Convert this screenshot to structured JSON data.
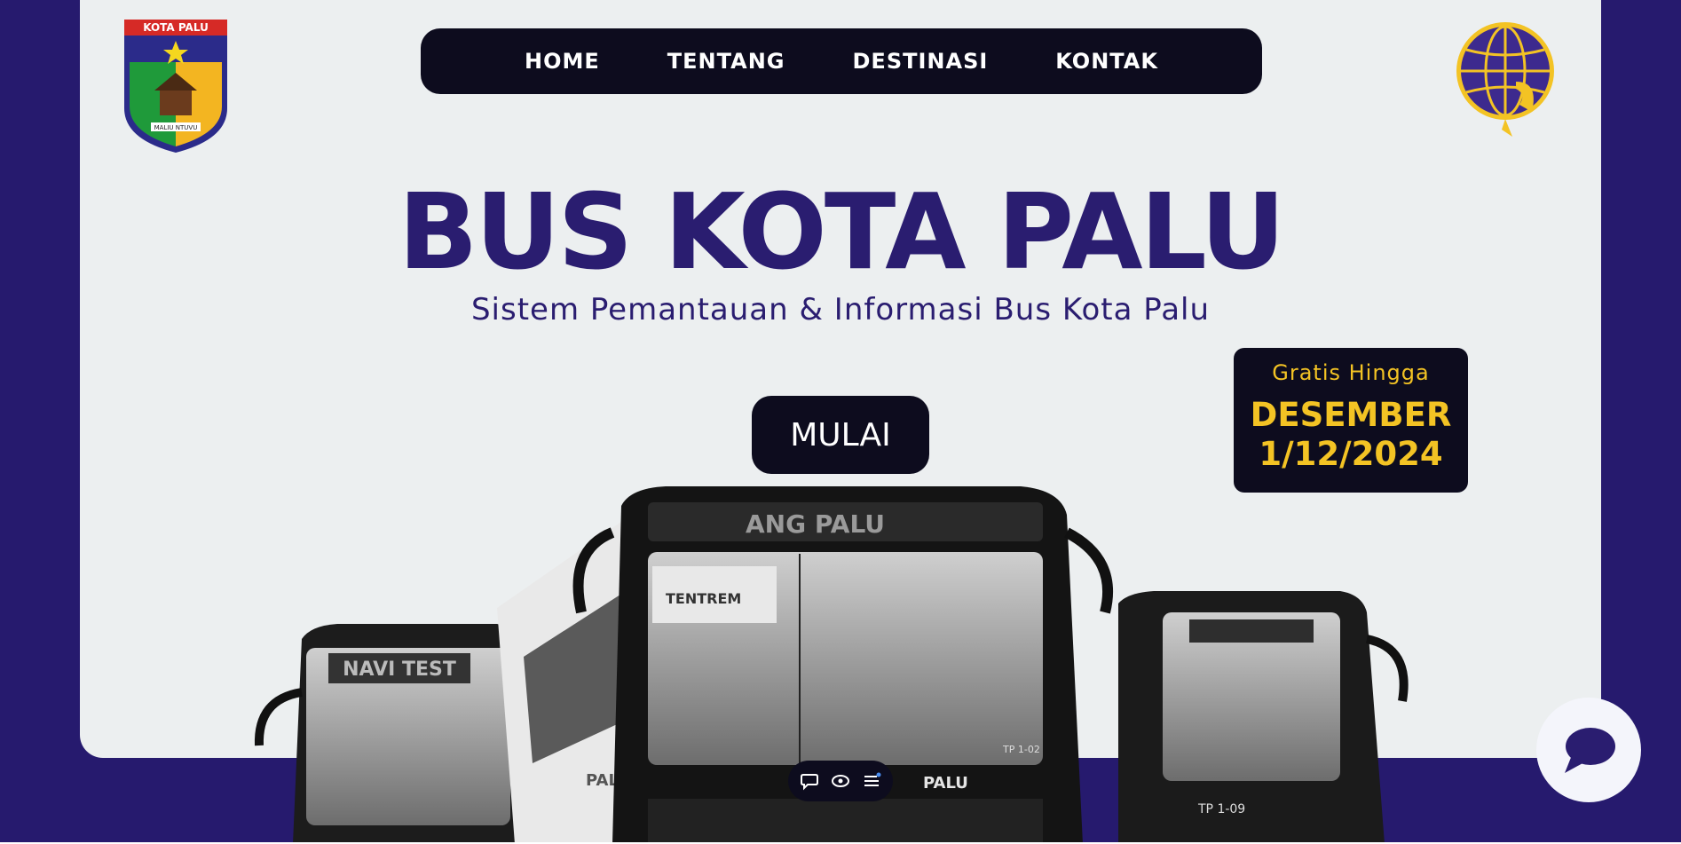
{
  "logos": {
    "left_banner_text": "KOTA PALU",
    "left_motto_text": "MALIU NTUVU"
  },
  "nav": {
    "items": [
      {
        "label": "HOME"
      },
      {
        "label": "TENTANG"
      },
      {
        "label": "DESTINASI"
      },
      {
        "label": "KONTAK"
      }
    ]
  },
  "hero": {
    "title": "BUS KOTA PALU",
    "subtitle": "Sistem Pemantauan & Informasi Bus Kota Palu",
    "start_button": "MULAI"
  },
  "promo": {
    "label": "Gratis Hingga",
    "month": "DESEMBER",
    "date": "1/12/2024"
  },
  "bus_image": {
    "left_bus_sign": "NAVI TEST",
    "center_bus_sign": "ANG PALU",
    "center_bus_banner": "TENTREM",
    "center_bus_brand": "PALU",
    "center_bus_side_brand": "PALU",
    "right_bus_plate": "TP 1-09",
    "center_bus_plate": "TP 1-02"
  },
  "colors": {
    "frame": "#261a6e",
    "panel": "#eceff0",
    "dark": "#0d0c1e",
    "accent_yellow": "#f3c324",
    "title": "#2a1d70"
  },
  "icons": [
    "comment-icon",
    "eye-icon",
    "menu-icon",
    "chat-bubble-icon"
  ]
}
